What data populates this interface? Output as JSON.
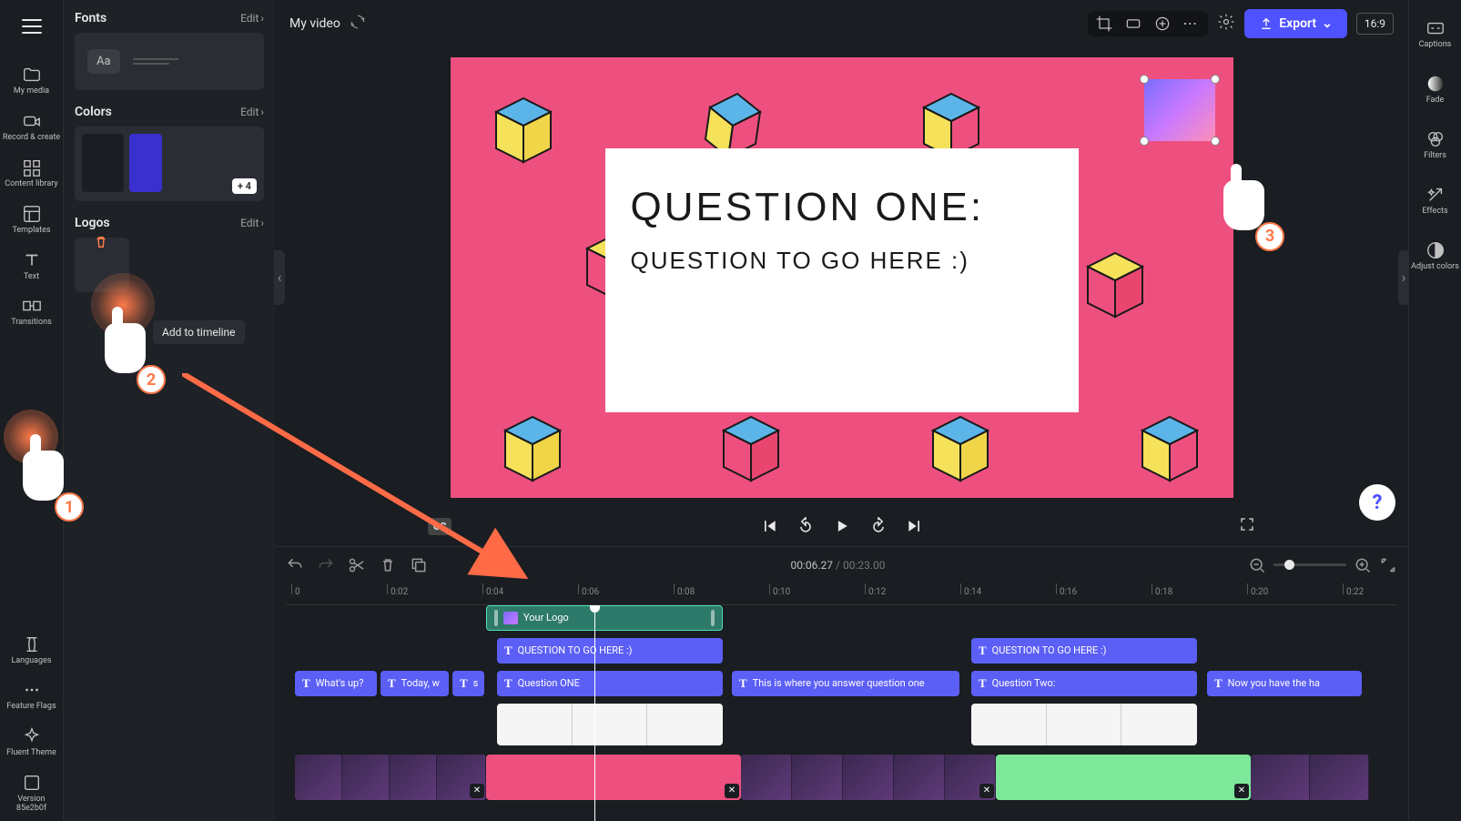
{
  "project": {
    "name": "My video"
  },
  "export_label": "Export",
  "aspect_ratio": "16:9",
  "left_rail": [
    {
      "icon": "folder",
      "label": "My media"
    },
    {
      "icon": "camera",
      "label": "Record & create"
    },
    {
      "icon": "library",
      "label": "Content library"
    },
    {
      "icon": "templates",
      "label": "Templates"
    },
    {
      "icon": "text",
      "label": "Text"
    },
    {
      "icon": "transitions",
      "label": "Transitions"
    }
  ],
  "left_rail_bottom": [
    {
      "icon": "globe",
      "label": "Languages"
    },
    {
      "icon": "dots",
      "label": "Feature Flags"
    },
    {
      "icon": "fluent",
      "label": "Fluent Theme"
    },
    {
      "icon": "version",
      "label": "Version 85e2b0f"
    }
  ],
  "panel": {
    "fonts": {
      "title": "Fonts",
      "edit": "Edit",
      "chip": "Aa"
    },
    "colors": {
      "title": "Colors",
      "edit": "Edit",
      "primary": "#3a2fcf",
      "more": "+ 4"
    },
    "logos": {
      "title": "Logos",
      "edit": "Edit"
    },
    "tooltip": "Add to timeline"
  },
  "right_rail": [
    {
      "icon": "cc",
      "label": "Captions"
    },
    {
      "icon": "fade",
      "label": "Fade"
    },
    {
      "icon": "filters",
      "label": "Filters"
    },
    {
      "icon": "effects",
      "label": "Effects"
    },
    {
      "icon": "adjust",
      "label": "Adjust colors"
    }
  ],
  "canvas": {
    "question_title": "QUESTION ONE:",
    "question_sub": "QUESTION TO GO HERE :)"
  },
  "timecode": {
    "current": "00:06.27",
    "duration": "00:23.00"
  },
  "ruler": [
    "0",
    "0:02",
    "0:04",
    "0:06",
    "0:08",
    "0:10",
    "0:12",
    "0:14",
    "0:16",
    "0:18",
    "0:20",
    "0:22"
  ],
  "clips": {
    "logo": "Your Logo",
    "q_here_1": "QUESTION TO GO HERE :)",
    "q_here_2": "QUESTION TO GO HERE :)",
    "whats_up": "What's up?",
    "today": "Today, w",
    "s": "s",
    "q_one": "Question ONE",
    "answer": "This is where you answer question one",
    "q_two": "Question Two:",
    "hang": "Now you have the ha"
  },
  "badges": {
    "1": "1",
    "2": "2",
    "3": "3"
  },
  "help": "?"
}
